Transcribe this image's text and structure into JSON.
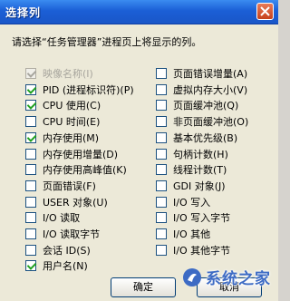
{
  "window": {
    "title": "选择列"
  },
  "instruction": "请选择“任务管理器”进程页上将显示的列。",
  "left_column": [
    {
      "label": "映像名称(I)",
      "checked": true,
      "disabled": true
    },
    {
      "label": "PID (进程标识符)(P)",
      "checked": true,
      "disabled": false
    },
    {
      "label": "CPU 使用(C)",
      "checked": true,
      "disabled": false
    },
    {
      "label": "CPU 时间(E)",
      "checked": false,
      "disabled": false
    },
    {
      "label": "内存使用(M)",
      "checked": true,
      "disabled": false
    },
    {
      "label": "内存使用增量(D)",
      "checked": false,
      "disabled": false
    },
    {
      "label": "内存使用高峰值(K)",
      "checked": false,
      "disabled": false
    },
    {
      "label": "页面错误(F)",
      "checked": false,
      "disabled": false
    },
    {
      "label": "USER 对象(U)",
      "checked": false,
      "disabled": false
    },
    {
      "label": "I/O 读取",
      "checked": false,
      "disabled": false
    },
    {
      "label": "I/O 读取字节",
      "checked": false,
      "disabled": false
    },
    {
      "label": "会话 ID(S)",
      "checked": false,
      "disabled": false
    },
    {
      "label": "用户名(N)",
      "checked": true,
      "disabled": false
    }
  ],
  "right_column": [
    {
      "label": "页面错误增量(A)",
      "checked": false,
      "disabled": false
    },
    {
      "label": "虚拟内存大小(V)",
      "checked": false,
      "disabled": false
    },
    {
      "label": "页面缓冲池(Q)",
      "checked": false,
      "disabled": false
    },
    {
      "label": "非页面缓冲池(O)",
      "checked": false,
      "disabled": false
    },
    {
      "label": "基本优先级(B)",
      "checked": false,
      "disabled": false
    },
    {
      "label": "句柄计数(H)",
      "checked": false,
      "disabled": false
    },
    {
      "label": "线程计数(T)",
      "checked": false,
      "disabled": false
    },
    {
      "label": "GDI 对象(J)",
      "checked": false,
      "disabled": false
    },
    {
      "label": "I/O 写入",
      "checked": false,
      "disabled": false
    },
    {
      "label": "I/O 写入字节",
      "checked": false,
      "disabled": false
    },
    {
      "label": "I/O 其他",
      "checked": false,
      "disabled": false
    },
    {
      "label": "I/O 其他字节",
      "checked": false,
      "disabled": false
    }
  ],
  "buttons": {
    "ok": "确定",
    "cancel": "取消"
  },
  "watermark": {
    "text": "系统之家"
  },
  "colors": {
    "titlebar": "#1b5fd6",
    "checkmark": "#21a121",
    "background": "#ece9d8"
  }
}
